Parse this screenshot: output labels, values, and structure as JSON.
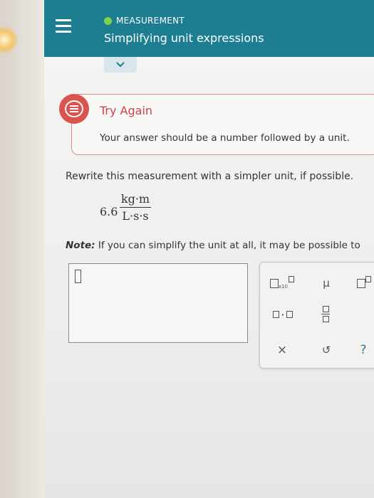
{
  "header": {
    "module": "MEASUREMENT",
    "title": "Simplifying unit expressions"
  },
  "icons": {
    "menu": "hamburger-menu-icon",
    "collapse": "chevron-down-icon",
    "alert": "feedback-alert-icon"
  },
  "alert": {
    "title": "Try Again",
    "message": "Your answer should be a number followed by a unit."
  },
  "problem": {
    "instruction": "Rewrite this measurement with a simpler unit, if possible.",
    "coefficient": "6.6",
    "numerator": "kg·m",
    "denominator": "L·s·s",
    "note_label": "Note:",
    "note_text": "If you can simplify the unit at all, it may be possible to"
  },
  "keypad": {
    "sci_label": "x10",
    "mu_label": "μ",
    "clear_label": "×",
    "undo_label": "↺",
    "help_label": "?"
  },
  "colors": {
    "header": "#1e7e91",
    "alert_red": "#d9534f",
    "module_dot": "#7fd14a"
  }
}
